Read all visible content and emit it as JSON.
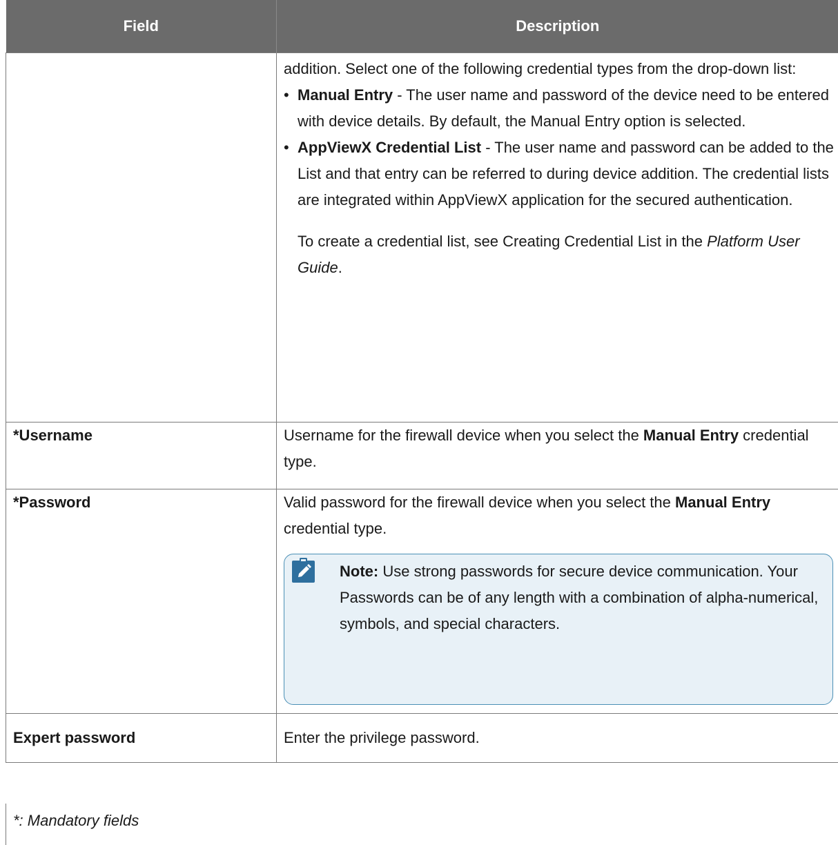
{
  "table": {
    "headers": {
      "field": "Field",
      "description": "Description"
    },
    "rows": {
      "credential_type": {
        "field": "",
        "intro": "addition. Select one of the following credential types from the drop-down list:",
        "bullets": [
          {
            "term": "Manual Entry",
            "text": " - The user name and password of the device need to be entered with device details. By default, the Manual Entry option is selected."
          },
          {
            "term": "AppViewX Credential List",
            "text": " - The user name and password can be added to the List and that entry can be referred to during device addition. The credential lists are integrated within AppViewX application for the secured authentication."
          }
        ],
        "sub_text": "To create a credential list, see Creating Credential List in the ",
        "sub_guide": "Platform User Guide",
        "sub_end": "."
      },
      "username": {
        "field": "*Username",
        "desc_before": "Username for the firewall device when you select the ",
        "desc_bold": "Manual Entry",
        "desc_after": " credential type."
      },
      "password": {
        "field": "*Password",
        "desc_before": "Valid password for the firewall device when you select the ",
        "desc_bold": "Manual Entry",
        "desc_after": " credential type.",
        "note": {
          "label": "Note:",
          "text": " Use strong passwords for secure device communication. Your Passwords can be of any length with a combination of alpha-numerical, symbols, and special characters.",
          "icon": "pencil-icon"
        }
      },
      "expert_password": {
        "field": "Expert password",
        "desc": "Enter the privilege password."
      }
    }
  },
  "footer": {
    "mandatory_note": "*: Mandatory fields"
  },
  "colors": {
    "header_bg": "#6b6b6b",
    "note_bg": "#e8f1f7",
    "note_border": "#4a8fb5",
    "note_icon": "#2e6f9e"
  }
}
